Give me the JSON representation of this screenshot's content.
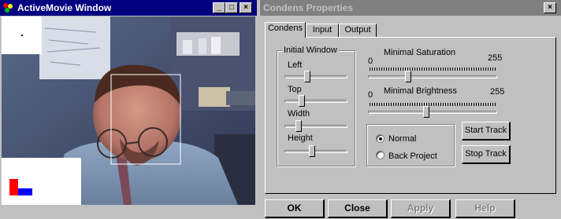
{
  "am_window": {
    "title": "ActiveMovie Window",
    "controls": [
      "_",
      "□",
      "×"
    ]
  },
  "cp_window": {
    "title": "Condens Properties",
    "close_glyph": "×",
    "tabs": [
      {
        "label": "Condens"
      },
      {
        "label": "Input"
      },
      {
        "label": "Output"
      }
    ],
    "initial_window": {
      "title": "Initial Window",
      "sliders": [
        {
          "label": "Left",
          "value": 0.35
        },
        {
          "label": "Top",
          "value": 0.25
        },
        {
          "label": "Width",
          "value": 0.2
        },
        {
          "label": "Height",
          "value": 0.43
        }
      ]
    },
    "min_saturation": {
      "label": "Minimal Saturation",
      "min": "0",
      "max": "255",
      "value": 0.3
    },
    "min_brightness": {
      "label": "Minimal Brightness",
      "min": "0",
      "max": "255",
      "value": 0.45
    },
    "mode": {
      "options": [
        {
          "label": "Normal",
          "selected": true
        },
        {
          "label": "Back Project",
          "selected": false
        }
      ]
    },
    "buttons": {
      "start": "Start Track",
      "stop": "Stop Track"
    },
    "footer": {
      "ok": "OK",
      "close": "Close",
      "apply": "Apply",
      "help": "Help"
    }
  }
}
